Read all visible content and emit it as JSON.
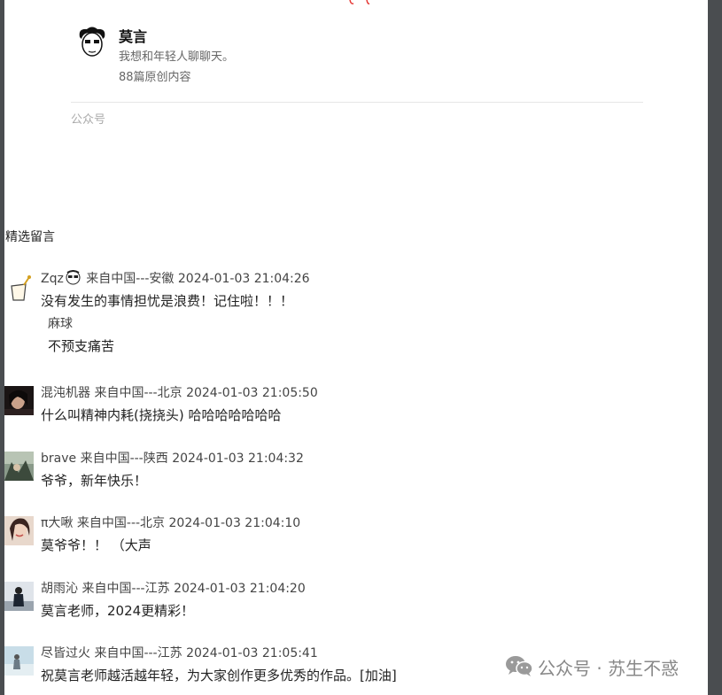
{
  "author": {
    "name": "莫言",
    "description": "我想和年轻人聊聊天。",
    "article_count": "88篇原创内容",
    "account_type": "公众号"
  },
  "comments_section": {
    "title": "精选留言",
    "comments": [
      {
        "user": "Zqz",
        "location": "来自中国---安徽",
        "time": "2024-01-03 21:04:26",
        "content": "没有发生的事情担忧是浪费！记住啦！！！",
        "reply": {
          "name": "麻球",
          "content": "不预支痛苦"
        }
      },
      {
        "user": "混沌机器",
        "location": "来自中国---北京",
        "time": "2024-01-03 21:05:50",
        "content": "什么叫精神内耗(挠挠头) 哈哈哈哈哈哈哈"
      },
      {
        "user": "brave",
        "location": "来自中国---陕西",
        "time": "2024-01-03 21:04:32",
        "content": "爷爷，新年快乐！"
      },
      {
        "user": "π大啾",
        "location": "来自中国---北京",
        "time": "2024-01-03 21:04:10",
        "content": "莫爷爷！！ （大声"
      },
      {
        "user": "胡雨沁",
        "location": "来自中国---江苏",
        "time": "2024-01-03 21:04:20",
        "content": "莫言老师，2024更精彩！"
      },
      {
        "user": "尽皆过火",
        "location": "来自中国---江苏",
        "time": "2024-01-03 21:05:41",
        "content": "祝莫言老师越活越年轻，为大家创作更多优秀的作品。[加油]"
      }
    ]
  },
  "watermark": {
    "text": "公众号 · 苏生不惑",
    "icon": "wechat-icon"
  },
  "colors": {
    "frame": "#4a4d50",
    "text": "#222222",
    "muted": "#888888",
    "accent_red": "#e53935"
  }
}
